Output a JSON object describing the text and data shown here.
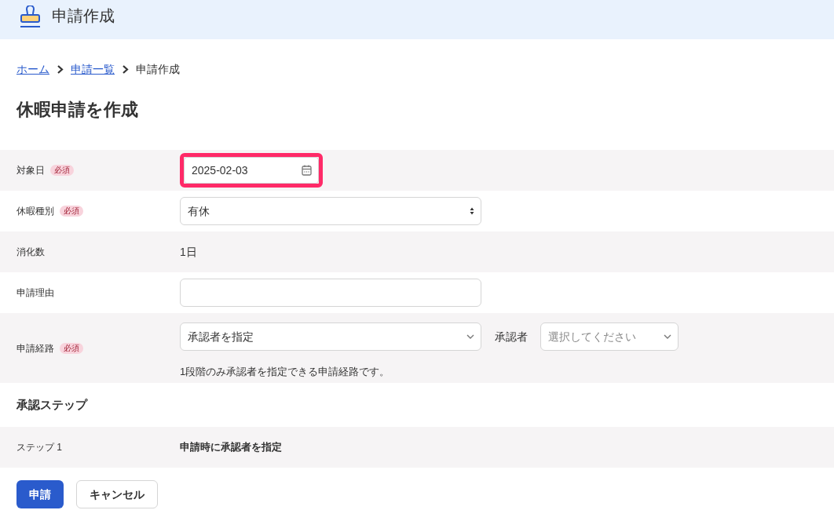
{
  "header": {
    "title": "申請作成"
  },
  "breadcrumb": [
    {
      "label": "ホーム",
      "kind": "link"
    },
    {
      "label": "申請一覧",
      "kind": "link"
    },
    {
      "label": "申請作成",
      "kind": "current"
    }
  ],
  "heading": "休暇申請を作成",
  "form": [
    {
      "label": "対象日",
      "badge": "必須",
      "kind": "date",
      "value": "2025-02-03",
      "highlighted": true
    },
    {
      "label": "休暇種別",
      "badge": "必須",
      "kind": "select",
      "value": "有休"
    },
    {
      "label": "消化数",
      "kind": "text",
      "value": "1日"
    },
    {
      "label": "申請理由",
      "kind": "input"
    },
    {
      "label": "申請経路",
      "badge": "必須",
      "kind": "route",
      "value": "承認者を指定",
      "approver_label": "承認者",
      "approver_placeholder": "選択してください",
      "help": "1段階のみ承認者を指定できる申請経路です。"
    }
  ],
  "steps_section": {
    "title": "承認ステップ",
    "steps": [
      {
        "label": "ステップ 1",
        "value": "申請時に承認者を指定"
      }
    ]
  },
  "buttons": [
    {
      "label": "申請",
      "kind": "primary"
    },
    {
      "label": "キャンセル",
      "kind": "secondary"
    }
  ]
}
